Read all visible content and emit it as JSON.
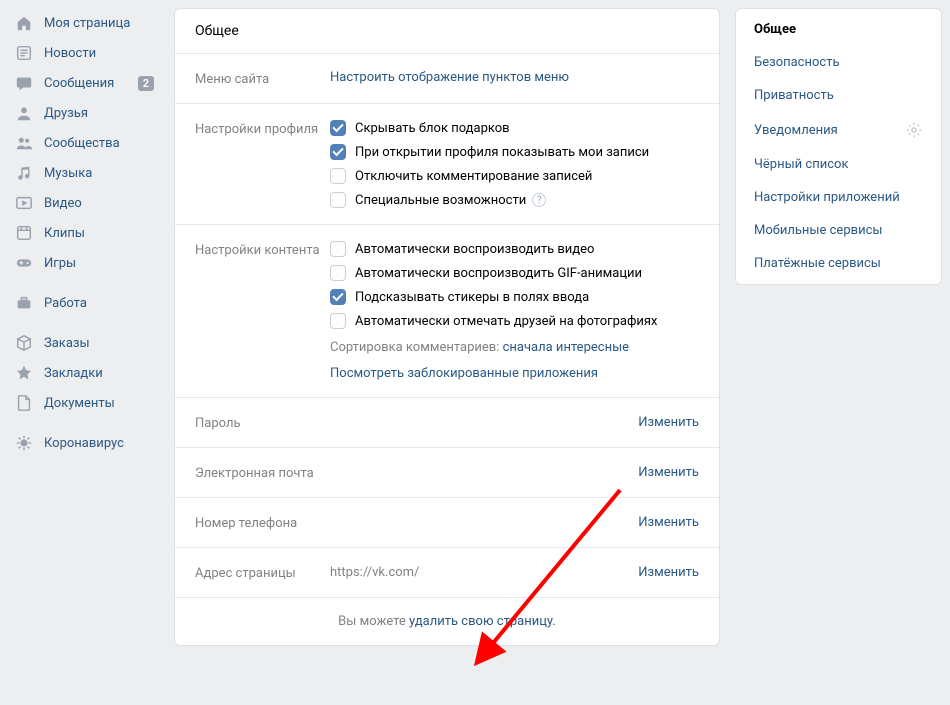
{
  "leftNav": {
    "items": [
      {
        "id": "my-page",
        "label": "Моя страница",
        "icon": "home"
      },
      {
        "id": "news",
        "label": "Новости",
        "icon": "news"
      },
      {
        "id": "messages",
        "label": "Сообщения",
        "icon": "chat",
        "badge": "2"
      },
      {
        "id": "friends",
        "label": "Друзья",
        "icon": "user"
      },
      {
        "id": "groups",
        "label": "Сообщества",
        "icon": "users"
      },
      {
        "id": "music",
        "label": "Музыка",
        "icon": "music"
      },
      {
        "id": "video",
        "label": "Видео",
        "icon": "video"
      },
      {
        "id": "clips",
        "label": "Клипы",
        "icon": "clips"
      },
      {
        "id": "games",
        "label": "Игры",
        "icon": "gamepad"
      }
    ],
    "items2": [
      {
        "id": "work",
        "label": "Работа",
        "icon": "briefcase"
      }
    ],
    "items3": [
      {
        "id": "orders",
        "label": "Заказы",
        "icon": "box"
      },
      {
        "id": "bookmarks",
        "label": "Закладки",
        "icon": "star"
      },
      {
        "id": "documents",
        "label": "Документы",
        "icon": "doc"
      }
    ],
    "items4": [
      {
        "id": "covid",
        "label": "Коронавирус",
        "icon": "virus"
      }
    ]
  },
  "main": {
    "title": "Общее",
    "menu": {
      "label": "Меню сайта",
      "link": "Настроить отображение пунктов меню"
    },
    "profile": {
      "label": "Настройки профиля",
      "opts": [
        {
          "label": "Скрывать блок подарков",
          "checked": true
        },
        {
          "label": "При открытии профиля показывать мои записи",
          "checked": true
        },
        {
          "label": "Отключить комментирование записей",
          "checked": false
        },
        {
          "label": "Специальные возможности",
          "checked": false,
          "help": true
        }
      ]
    },
    "content": {
      "label": "Настройки контента",
      "opts": [
        {
          "label": "Автоматически воспроизводить видео",
          "checked": false
        },
        {
          "label": "Автоматически воспроизводить GIF-анимации",
          "checked": false
        },
        {
          "label": "Подсказывать стикеры в полях ввода",
          "checked": true
        },
        {
          "label": "Автоматически отмечать друзей на фотографиях",
          "checked": false
        }
      ],
      "sort_label": "Сортировка комментариев: ",
      "sort_value": "сначала интересные",
      "blocked_apps": "Посмотреть заблокированные приложения"
    },
    "rows": [
      {
        "id": "password",
        "label": "Пароль",
        "value": "",
        "action": "Изменить"
      },
      {
        "id": "email",
        "label": "Электронная почта",
        "value": "",
        "action": "Изменить"
      },
      {
        "id": "phone",
        "label": "Номер телефона",
        "value": "",
        "action": "Изменить"
      },
      {
        "id": "address",
        "label": "Адрес страницы",
        "value": "https://vk.com/",
        "action": "Изменить"
      }
    ],
    "footer": {
      "prefix": "Вы можете ",
      "link": "удалить свою страницу."
    }
  },
  "right": {
    "items": [
      {
        "id": "general",
        "label": "Общее",
        "active": true
      },
      {
        "id": "security",
        "label": "Безопасность"
      },
      {
        "id": "privacy",
        "label": "Приватность"
      },
      {
        "id": "notifications",
        "label": "Уведомления",
        "gear": true
      },
      {
        "id": "blacklist",
        "label": "Чёрный список"
      },
      {
        "id": "apps",
        "label": "Настройки приложений"
      },
      {
        "id": "mobile",
        "label": "Мобильные сервисы"
      },
      {
        "id": "payments",
        "label": "Платёжные сервисы"
      }
    ]
  }
}
